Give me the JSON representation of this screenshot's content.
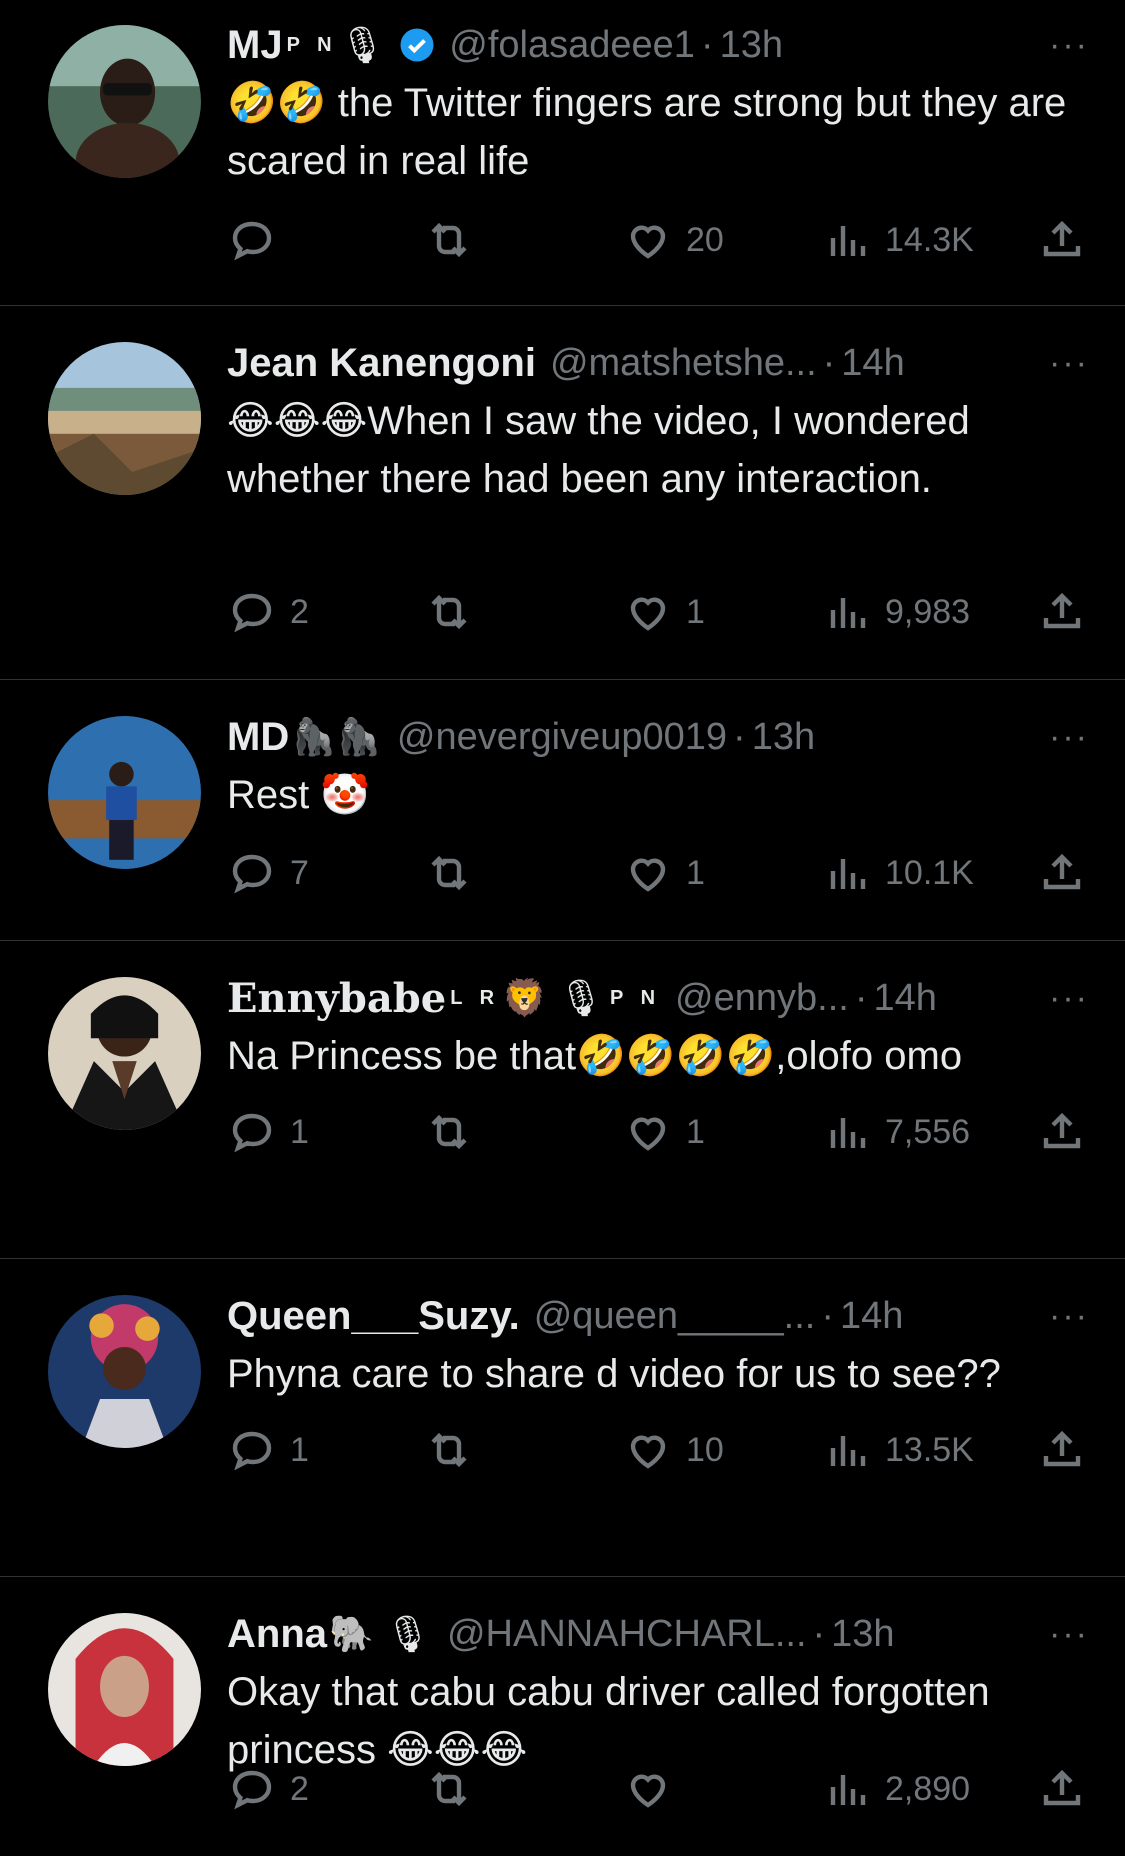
{
  "tweets": [
    {
      "name": "MJ",
      "name_sup": "P N",
      "name_emojis": "🎙",
      "verified": true,
      "handle": "@folasadeee1",
      "time": "13h",
      "text": "🤣🤣 the Twitter fingers are strong but they are scared in real life",
      "reply_count": "",
      "like_count": "20",
      "views": "14.3K"
    },
    {
      "name": "Jean Kanengoni",
      "name_sup": "",
      "name_emojis": "",
      "verified": false,
      "handle": "@matshetshe...",
      "time": "14h",
      "text": "😂😂😂When I saw the video, I wondered whether there had been any interaction.",
      "reply_count": "2",
      "like_count": "1",
      "views": "9,983"
    },
    {
      "name": "MD",
      "name_sup": "",
      "name_emojis": "🦍🦍",
      "verified": false,
      "handle": "@nevergiveup0019",
      "time": "13h",
      "text": "Rest 🤡",
      "reply_count": "7",
      "like_count": "1",
      "views": "10.1K"
    },
    {
      "name": "Ennybabe",
      "name_sup": "L R",
      "name_emojis": "🦁 🎙",
      "name_sup2": "P N",
      "verified": false,
      "handle": "@ennyb...",
      "time": "14h",
      "text": "Na Princess be that🤣🤣🤣🤣,olofo omo",
      "reply_count": "1",
      "like_count": "1",
      "views": "7,556"
    },
    {
      "name": "Queen___Suzy.",
      "name_sup": "",
      "name_emojis": "",
      "verified": false,
      "handle": "@queen_____...",
      "time": "14h",
      "text": "Phyna care to share d video for us to see??",
      "reply_count": "1",
      "like_count": "10",
      "views": "13.5K"
    },
    {
      "name": "Anna",
      "name_sup": "",
      "name_emojis": "🐘 🎙",
      "verified": false,
      "handle": "@HANNAHCHARL...",
      "time": "13h",
      "text": "Okay that cabu cabu driver called forgotten princess 😂😂😂",
      "reply_count": "2",
      "like_count": "",
      "views": "2,890"
    }
  ],
  "ui": {
    "more": "···",
    "dot": "·"
  },
  "colors": {
    "bg": "#000000",
    "text": "#e7e9ea",
    "muted": "#71767b",
    "divider": "#2f3336",
    "verified": "#1d9bf0"
  },
  "icons": [
    "reply-icon",
    "retweet-icon",
    "like-icon",
    "views-icon",
    "share-icon",
    "more-icon",
    "verified-icon"
  ]
}
